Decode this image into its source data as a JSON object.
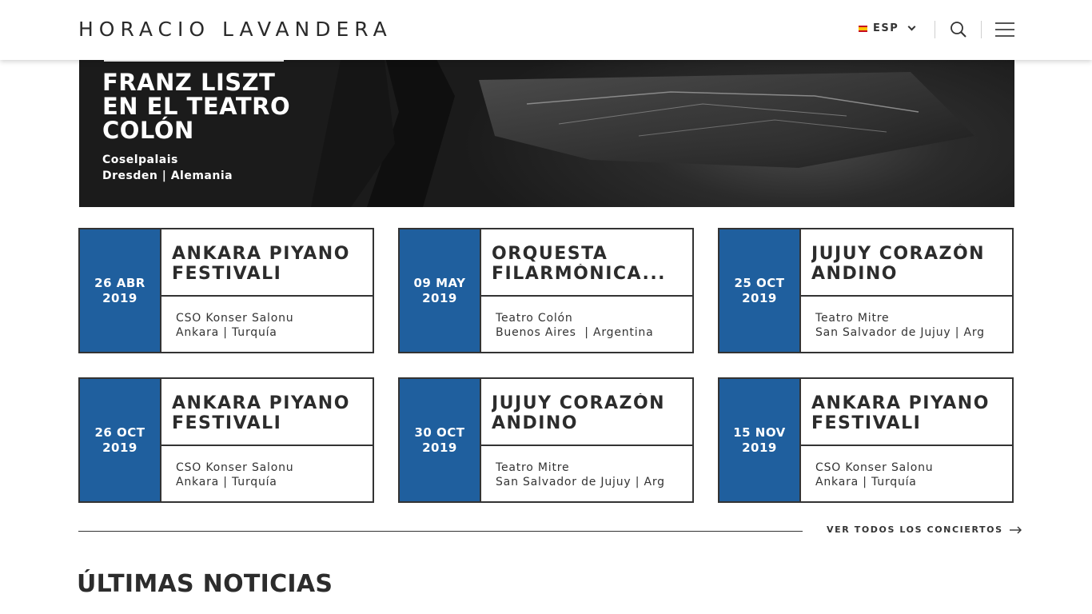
{
  "header": {
    "brand": "HORACIO LAVANDERA",
    "language": "ESP"
  },
  "hero": {
    "title_lines": [
      "FRANZ LISZT",
      "EN EL TEATRO",
      "COLÓN"
    ],
    "venue": "Coselpalais",
    "location": "Dresden | Alemania"
  },
  "concerts": [
    {
      "day_month": "26 ABR",
      "year": "2019",
      "title_lines": [
        "ANKARA PIYANO",
        "FESTIVALI"
      ],
      "venue": "CSO Konser Salonu",
      "location": "Ankara | Turquía"
    },
    {
      "day_month": "09 MAY",
      "year": "2019",
      "title_lines": [
        "ORQUESTA",
        "FILARMÓNICA..."
      ],
      "venue": "Teatro Colón",
      "location": "Buenos Aires  | Argentina"
    },
    {
      "day_month": "25 OCT",
      "year": "2019",
      "title_lines": [
        "JUJUY CORAZÓN",
        "ANDINO"
      ],
      "venue": "Teatro Mitre",
      "location": "San Salvador de Jujuy | Arg"
    },
    {
      "day_month": "26 OCT",
      "year": "2019",
      "title_lines": [
        "ANKARA PIYANO",
        "FESTIVALI"
      ],
      "venue": "CSO Konser Salonu",
      "location": "Ankara | Turquía"
    },
    {
      "day_month": "30 OCT",
      "year": "2019",
      "title_lines": [
        "JUJUY CORAZÓN",
        "ANDINO"
      ],
      "venue": "Teatro Mitre",
      "location": "San Salvador de Jujuy | Arg"
    },
    {
      "day_month": "15 NOV",
      "year": "2019",
      "title_lines": [
        "ANKARA PIYANO",
        "FESTIVALI"
      ],
      "venue": "CSO Konser Salonu",
      "location": "Ankara | Turquía"
    }
  ],
  "see_all_label": "VER TODOS LOS CONCIERTOS",
  "news_heading": "ÚLTIMAS NOTICIAS",
  "colors": {
    "accent_blue": "#1f5f9e",
    "hero_bg": "#1b1b1b",
    "text_dark": "#2c2c2c"
  },
  "icons": {
    "flag": "spain-flag-icon",
    "language_toggle": "chevron-down-icon",
    "search": "search-icon",
    "menu": "hamburger-menu-icon",
    "see_all": "arrow-right-icon"
  }
}
